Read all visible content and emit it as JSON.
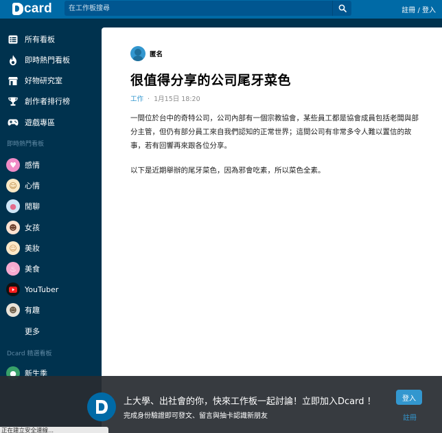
{
  "header": {
    "logo_text": "card",
    "search_placeholder": "在工作板搜尋",
    "auth_link": "註冊 / 登入"
  },
  "sidebar": {
    "nav": [
      {
        "label": "所有看板",
        "icon": "list-icon"
      },
      {
        "label": "即時熱門看板",
        "icon": "flame-icon"
      },
      {
        "label": "好物研究室",
        "icon": "store-icon"
      },
      {
        "label": "創作者排行榜",
        "icon": "trophy-icon"
      },
      {
        "label": "遊戲專區",
        "icon": "gamepad-icon"
      }
    ],
    "hot_section_title": "即時熱門看板",
    "boards": [
      {
        "label": "感情",
        "icon": "heart-icon"
      },
      {
        "label": "心情",
        "icon": "smile-icon"
      },
      {
        "label": "閒聊",
        "icon": "chat-icon"
      },
      {
        "label": "女孩",
        "icon": "girl-icon"
      },
      {
        "label": "美妝",
        "icon": "makeup-icon"
      },
      {
        "label": "美食",
        "icon": "food-icon"
      },
      {
        "label": "YouTuber",
        "icon": "youtube-icon"
      },
      {
        "label": "有趣",
        "icon": "funny-icon"
      }
    ],
    "more_label": "更多",
    "featured_section_title": "Dcard 精選看板",
    "featured_boards": [
      {
        "label": "新生季",
        "icon": "freshman-icon"
      }
    ]
  },
  "post": {
    "author": "匿名",
    "title": "很值得分享的公司尾牙菜色",
    "forum": "工作",
    "separator": "·",
    "date": "1月15日 18:20",
    "paragraphs": [
      "一間位於台中的奇特公司，公司內部有一個宗教協會，某些員工都是協會成員包括老闆與部分主管，但仍有部分員工來自我們認知的正常世界；這間公司有非常多令人難以置信的故事，若有回響再來跟各位分享。",
      "以下是近期舉辦的尾牙菜色，因為邪會吃素，所以菜色全素。"
    ]
  },
  "promo": {
    "main_text": "上大學、出社會的你，快來工作板一起討論！立即加入Dcard ！",
    "sub_text": "完成身份驗證即可發文、留言與抽卡認識新朋友",
    "login_label": "登入",
    "register_label": "註冊"
  },
  "status_tip": "正在建立安全連線...",
  "colors": {
    "header_bg": "#006aa6",
    "sidebar_bg": "#00324e",
    "accent": "#3397cf"
  }
}
